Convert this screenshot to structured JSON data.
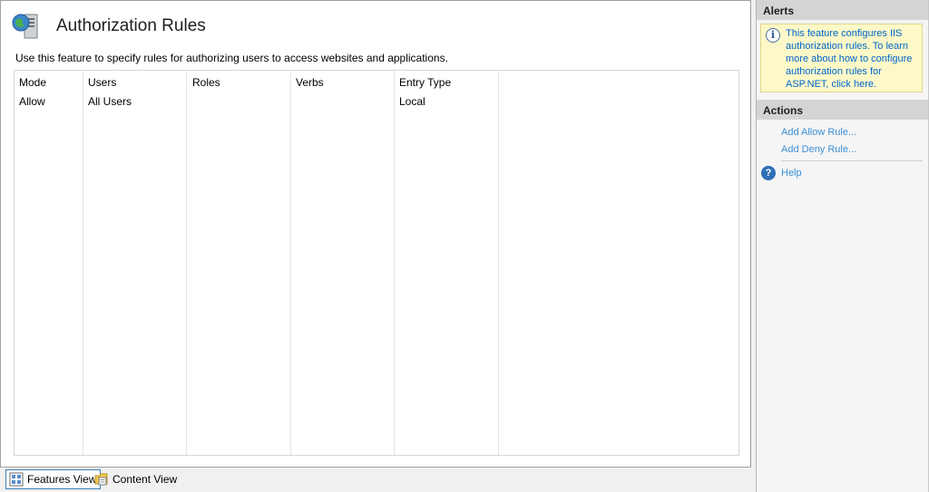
{
  "page": {
    "title": "Authorization Rules",
    "description": "Use this feature to specify rules for authorizing users to access websites and applications."
  },
  "grid": {
    "columns": [
      "Mode",
      "Users",
      "Roles",
      "Verbs",
      "Entry Type"
    ],
    "rows": [
      {
        "mode": "Allow",
        "users": "All Users",
        "roles": "",
        "verbs": "",
        "entry_type": "Local"
      }
    ]
  },
  "views": {
    "features": "Features View",
    "content": "Content View"
  },
  "alerts": {
    "header": "Alerts",
    "message": "This feature configures IIS authorization rules. To learn more about how to configure authorization rules for ASP.NET, click here."
  },
  "actions": {
    "header": "Actions",
    "add_allow": "Add Allow Rule...",
    "add_deny": "Add Deny Rule...",
    "help": "Help"
  },
  "colors": {
    "link": "#3a8fd6",
    "alert_bg": "#fdf8c8",
    "pane_header": "#d4d4d4"
  }
}
